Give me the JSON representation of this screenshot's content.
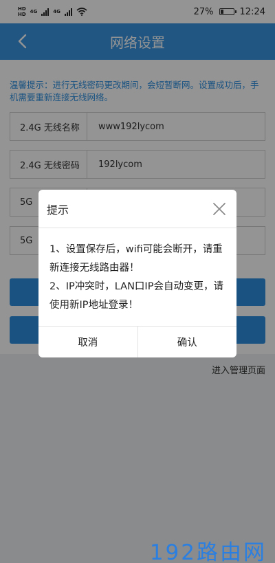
{
  "status_bar": {
    "network_left": "4G",
    "network_right": "4G",
    "battery": "27%",
    "battery_level": 0.27,
    "time": "12:24"
  },
  "header": {
    "title": "网络设置",
    "back_icon": "chevron-left-icon"
  },
  "tip": "温馨提示：进行无线密码更改期间，会短暂断网。设置成功后，手机需要重新连接无线网络。",
  "form": {
    "rows": [
      {
        "label": "2.4G 无线名称",
        "value": "www192lycom"
      },
      {
        "label": "2.4G 无线密码",
        "value": "192lycom"
      },
      {
        "label": "5G",
        "value": ""
      },
      {
        "label": "5G",
        "value": ""
      }
    ]
  },
  "management_link": "进入管理页面",
  "dialog": {
    "title": "提示",
    "line1": "1、设置保存后，wifi可能会断开，请重新连接无线路由器！",
    "line2": "2、IP冲突时，LAN口IP会自动变更，请使用新IP地址登录！",
    "cancel": "取消",
    "confirm": "确认"
  },
  "watermark": "192路由网",
  "colors": {
    "primary": "#3a94e0",
    "tip_text": "#2d8fe0",
    "watermark": "#2a7fe0"
  }
}
